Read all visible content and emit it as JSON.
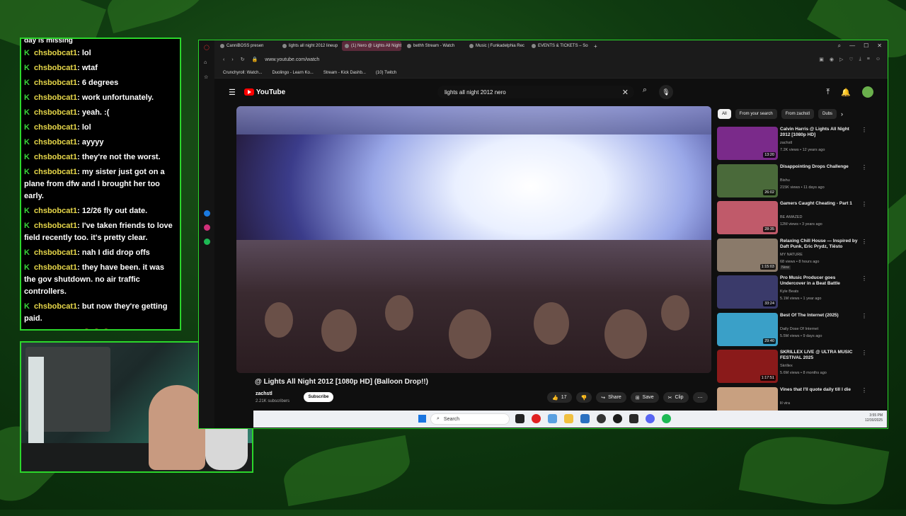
{
  "chat": {
    "top_text": "day is missing",
    "messages": [
      {
        "user": "chsbobcat1",
        "text": ": lol"
      },
      {
        "user": "chsbobcat1",
        "text": ": wtaf"
      },
      {
        "user": "chsbobcat1",
        "text": ": 6 degrees"
      },
      {
        "user": "chsbobcat1",
        "text": ": work unfortunately."
      },
      {
        "user": "chsbobcat1",
        "text": ": yeah. :("
      },
      {
        "user": "chsbobcat1",
        "text": ": lol"
      },
      {
        "user": "chsbobcat1",
        "text": ": ayyyy"
      },
      {
        "user": "chsbobcat1",
        "text": ": they're not the worst."
      },
      {
        "user": "chsbobcat1",
        "text": ": my sister just got on a plane from dfw and I brought her too early."
      },
      {
        "user": "chsbobcat1",
        "text": ": 12/26 fly out date."
      },
      {
        "user": "chsbobcat1",
        "text": ": I've taken friends to love field recently too. it's pretty clear."
      },
      {
        "user": "chsbobcat1",
        "text": ": nah I did drop offs"
      },
      {
        "user": "chsbobcat1",
        "text": ": they have been. it was the gov shutdown. no air traffic controllers."
      },
      {
        "user": "chsbobcat1",
        "text": ": but now they're getting paid."
      },
      {
        "user": "chsbobcat1",
        "text": ": 😳😳😳"
      },
      {
        "user": "chsbobcat1",
        "text": ": 😳"
      }
    ]
  },
  "browser": {
    "tabs": [
      {
        "label": "CanniBOSS presen"
      },
      {
        "label": "lights all night 2012 lineup"
      },
      {
        "label": "(1) Nero @ Lights All Night",
        "active": true
      },
      {
        "label": "bethh Stream - Watch"
      },
      {
        "label": "Music | Funkadelphia Rec"
      },
      {
        "label": "EVENTS & TICKETS – Sou"
      }
    ],
    "url": "www.youtube.com/watch",
    "bookmarks": [
      "Crunchyroll: Watch...",
      "Duolingo - Learn Ko...",
      "Stream - Kick Dashb...",
      "(10) Twitch"
    ]
  },
  "youtube": {
    "logo": "YouTube",
    "search_query": "lights all night 2012 nero",
    "video_title": "@ Lights All Night 2012 [1080p HD] (Balloon Drop!!)",
    "channel": "zachstl",
    "subscribers": "2.21K subscribers",
    "subscribe_label": "Subscribe",
    "likes": "17",
    "share_label": "Share",
    "save_label": "Save",
    "clip_label": "Clip",
    "chips": [
      "All",
      "From your search",
      "From zachstl",
      "Dubs"
    ],
    "recommendations": [
      {
        "title": "Calvin Harris @ Lights All Night 2012 [1080p HD]",
        "channel": "zachstl",
        "meta": "7.2K views • 12 years ago",
        "duration": "13:20",
        "color": "#7a2a8a"
      },
      {
        "title": "Disappointing Drops Challenge",
        "channel": "Bishu",
        "meta": "215K views • 11 days ago",
        "duration": "26:02",
        "color": "#4a6a3a"
      },
      {
        "title": "Gamers Caught Cheating - Part 1",
        "channel": "BE AMAZED",
        "meta": "12M views • 3 years ago",
        "duration": "28:35",
        "color": "#c05a6a"
      },
      {
        "title": "Relaxing Chill House — Inspired by Daft Punk, Eric Prydz, Tiësto",
        "channel": "MY NATURE",
        "meta": "68 views • 8 hours ago",
        "duration": "1:15:03",
        "badge": "New",
        "color": "#8a7a6a"
      },
      {
        "title": "Pro Music Producer goes Undercover in a Beat Battle",
        "channel": "Kyle Beats",
        "meta": "5.1M views • 1 year ago",
        "duration": "33:24",
        "color": "#3a3a6a"
      },
      {
        "title": "Best Of The Internet (2025)",
        "channel": "Daily Dose Of Internet",
        "meta": "5.5M views • 9 days ago",
        "duration": "29:40",
        "color": "#3aa0c8"
      },
      {
        "title": "SKRILLEX LIVE @ ULTRA MUSIC FESTIVAL 2025",
        "channel": "Skrillex",
        "meta": "5.6M views • 8 months ago",
        "duration": "1:17:51",
        "color": "#8a1a1a"
      },
      {
        "title": "Vines that I'll quote daily till I die",
        "channel": "lil vira",
        "meta": "",
        "duration": "",
        "color": "#c8a080"
      }
    ]
  },
  "taskbar": {
    "search_placeholder": "Search",
    "time": "3:55 PM",
    "date": "12/30/2025"
  }
}
